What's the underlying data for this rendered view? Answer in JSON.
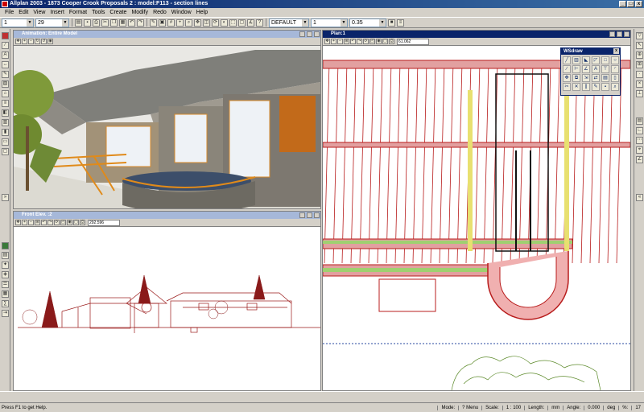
{
  "window": {
    "title": "Allplan 2003 - 1873 Cooper Crook Proposals 2 : model:F113 - section lines"
  },
  "menu": [
    "File",
    "Edit",
    "View",
    "Insert",
    "Format",
    "Tools",
    "Create",
    "Modify",
    "Redo",
    "Window",
    "Help"
  ],
  "toolbar": {
    "pen_value": "1",
    "line_value": "29",
    "layer_value": "DEFAULT",
    "linetype_value": "1",
    "thickness_value": "0.35"
  },
  "views": {
    "animation": {
      "title": "Animation: Entire Model"
    },
    "front": {
      "title": "Front Elev. :2",
      "zoom": "292.596"
    },
    "plan": {
      "title": "Plan:1",
      "zoom": "61.062"
    }
  },
  "wsdraw": {
    "title": "WSdraw",
    "tools": [
      "line-icon",
      "hatch-icon",
      "fill-icon",
      "polyline-icon",
      "rect-icon",
      "circle-icon",
      "offset-icon",
      "dim-icon",
      "angle-icon",
      "text-icon",
      "label-icon",
      "arc-icon",
      "move-icon",
      "copy-icon",
      "stretch-icon",
      "mirror-icon",
      "paste-icon",
      "doc-icon",
      "cut-icon",
      "delete-icon",
      "parallel-icon",
      "edit-icon",
      "save-icon",
      "search-icon"
    ]
  },
  "status": {
    "help": "Press F1 to get Help.",
    "mode": "Mode:",
    "mode_value": "? Menu",
    "scale_label": "Scale:",
    "scale_value": "1 : 100",
    "length_label": "Length:",
    "length_value": "mm",
    "angle_label": "Angle:",
    "angle_value": "0.000",
    "deg_label": "deg",
    "pct_label": "%:",
    "pct_value": "17"
  },
  "colors": {
    "plan_red": "#b81c1c",
    "plan_green": "#6fb83a",
    "elev_red": "#9a1a1a",
    "tree_green": "#5c8a2a",
    "title_active": "#0a246a"
  }
}
